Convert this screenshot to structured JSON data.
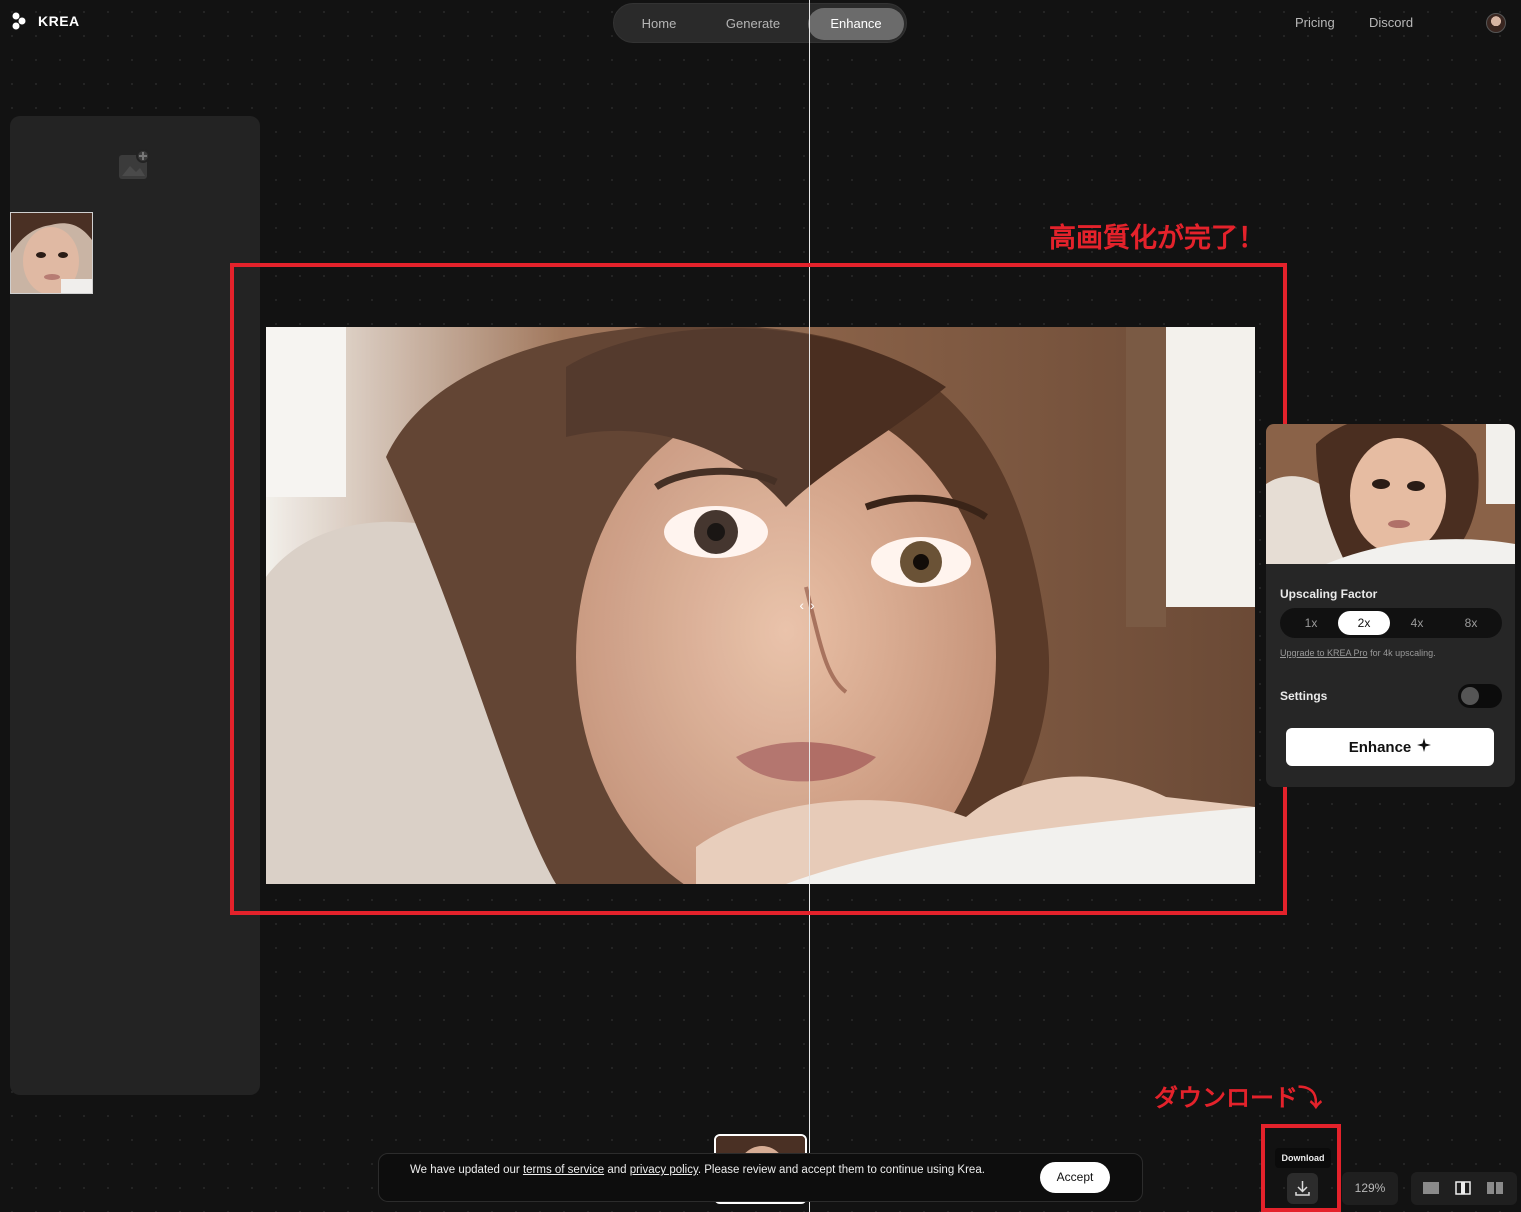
{
  "app": {
    "name": "KREA"
  },
  "nav": {
    "tabs": [
      {
        "label": "Home"
      },
      {
        "label": "Generate"
      },
      {
        "label": "Enhance",
        "active": true
      }
    ],
    "links": [
      "Pricing",
      "Discord"
    ]
  },
  "annotations": {
    "title": "高画質化が完了！",
    "download": "ダウンロード⤵"
  },
  "settings_panel": {
    "upscaling_label": "Upscaling Factor",
    "factors": [
      "1x",
      "2x",
      "4x",
      "8x"
    ],
    "selected_factor": "2x",
    "upgrade_link": "Upgrade to KREA Pro",
    "upgrade_rest": " for 4k upscaling.",
    "settings_label": "Settings",
    "settings_on": false,
    "enhance_label": "Enhance"
  },
  "cookie": {
    "text_1": "We have updated our ",
    "terms": "terms of service",
    "text_2": " and ",
    "privacy": "privacy policy",
    "text_3": ". Please review and accept them to continue using Krea.",
    "accept_label": "Accept"
  },
  "toolbar": {
    "download_tooltip": "Download",
    "zoom": "129%"
  },
  "colors": {
    "annotation_red": "#e4222b",
    "background": "#121212"
  }
}
